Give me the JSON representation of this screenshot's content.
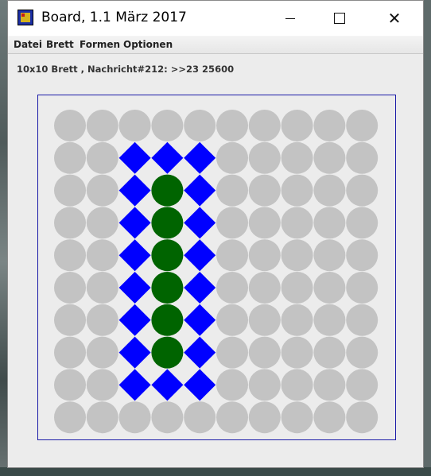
{
  "window": {
    "title": "Board, 1.1 März 2017",
    "app_icon": "board-app-icon",
    "controls": {
      "minimize_icon": "minimize-icon",
      "maximize_icon": "maximize-icon",
      "close_icon": "close-icon",
      "close_glyph": "✕"
    }
  },
  "menu": {
    "items": [
      "Datei",
      "Brett",
      "Formen",
      "Optionen"
    ]
  },
  "status": {
    "text": "10x10 Brett , Nachricht#212: >>23 25600"
  },
  "board": {
    "rows": 10,
    "cols": 10,
    "colors": {
      "empty": "#c3c3c3",
      "diamond": "#0000ff",
      "green_circle": "#006400",
      "frame": "#1a1aa8",
      "background": "#ececec"
    },
    "cells": [
      [
        "c",
        "c",
        "c",
        "c",
        "c",
        "c",
        "c",
        "c",
        "c",
        "c"
      ],
      [
        "c",
        "c",
        "d",
        "d",
        "d",
        "c",
        "c",
        "c",
        "c",
        "c"
      ],
      [
        "c",
        "c",
        "d",
        "g",
        "d",
        "c",
        "c",
        "c",
        "c",
        "c"
      ],
      [
        "c",
        "c",
        "d",
        "g",
        "d",
        "c",
        "c",
        "c",
        "c",
        "c"
      ],
      [
        "c",
        "c",
        "d",
        "g",
        "d",
        "c",
        "c",
        "c",
        "c",
        "c"
      ],
      [
        "c",
        "c",
        "d",
        "g",
        "d",
        "c",
        "c",
        "c",
        "c",
        "c"
      ],
      [
        "c",
        "c",
        "d",
        "g",
        "d",
        "c",
        "c",
        "c",
        "c",
        "c"
      ],
      [
        "c",
        "c",
        "d",
        "g",
        "d",
        "c",
        "c",
        "c",
        "c",
        "c"
      ],
      [
        "c",
        "c",
        "d",
        "d",
        "d",
        "c",
        "c",
        "c",
        "c",
        "c"
      ],
      [
        "c",
        "c",
        "c",
        "c",
        "c",
        "c",
        "c",
        "c",
        "c",
        "c"
      ]
    ]
  }
}
